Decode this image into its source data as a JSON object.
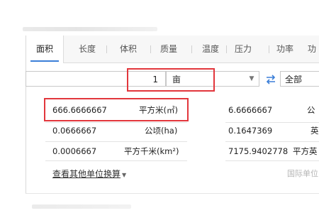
{
  "tabs": [
    "面积",
    "长度",
    "体积",
    "质量",
    "温度",
    "压力",
    "功率",
    "功"
  ],
  "input": {
    "value": "1",
    "unit": "亩",
    "category": "全部"
  },
  "results": [
    {
      "value": "666.6666667",
      "unit": "平方米(㎡)",
      "value2": "6.6666667",
      "unit2": "公"
    },
    {
      "value": "0.0666667",
      "unit": "公顷(ha)",
      "value2": "0.1647369",
      "unit2": "英"
    },
    {
      "value": "0.0006667",
      "unit": "平方千米(km²)",
      "value2": "7175.9402778",
      "unit2": "平方英"
    }
  ],
  "footer": {
    "link": "查看其他单位换算",
    "right": "国际单位"
  },
  "colors": {
    "highlight": "#e2363c",
    "accent": "#3b7fd8"
  }
}
